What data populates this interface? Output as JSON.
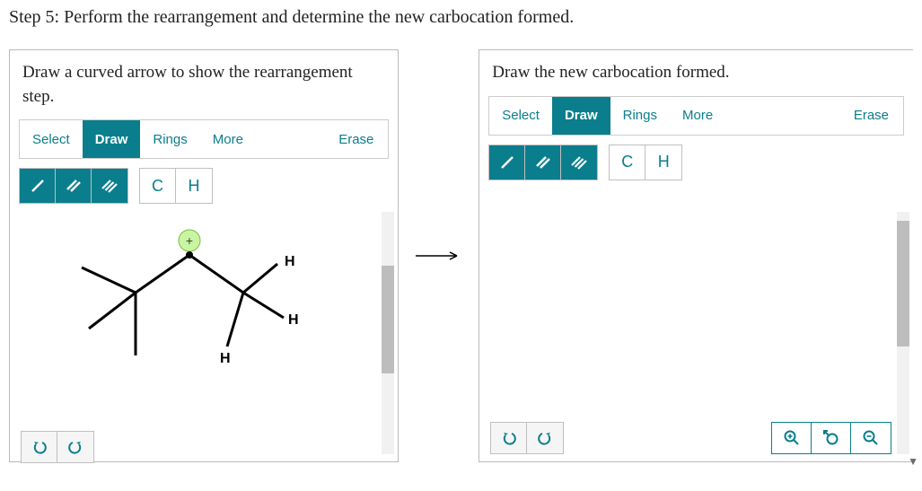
{
  "step_title": "Step 5: Perform the rearrangement and determine the new carbocation formed.",
  "arrow_symbol": "⟶",
  "left_panel": {
    "prompt": "Draw a curved arrow to show the rearrangement step.",
    "toolbar": {
      "select": "Select",
      "draw": "Draw",
      "rings": "Rings",
      "more": "More",
      "erase": "Erase"
    },
    "bond_buttons": {
      "single": "/",
      "double": "//",
      "triple": "///"
    },
    "element_buttons": {
      "C": "C",
      "H": "H"
    },
    "molecule_labels": {
      "H1": "H",
      "H2": "H",
      "H3": "H",
      "plus": "+"
    }
  },
  "right_panel": {
    "prompt": "Draw the new carbocation formed.",
    "toolbar": {
      "select": "Select",
      "draw": "Draw",
      "rings": "Rings",
      "more": "More",
      "erase": "Erase"
    },
    "bond_buttons": {
      "single": "/",
      "double": "//",
      "triple": "///"
    },
    "element_buttons": {
      "C": "C",
      "H": "H"
    }
  }
}
